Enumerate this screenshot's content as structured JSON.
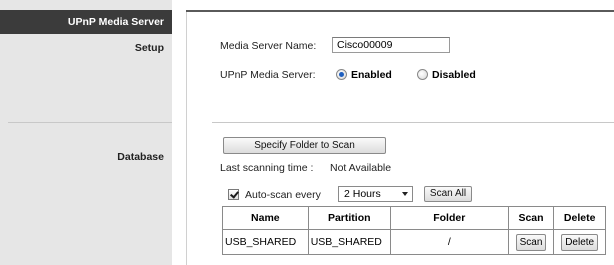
{
  "sidebar": {
    "header": "UPnP Media Server",
    "setup_label": "Setup",
    "database_label": "Database"
  },
  "setup": {
    "server_name_label": "Media Server Name:",
    "server_name_value": "Cisco00009",
    "upnp_label": "UPnP Media Server:",
    "enabled_label": "Enabled",
    "disabled_label": "Disabled",
    "selected": "Enabled"
  },
  "database": {
    "specify_button": "Specify Folder to Scan",
    "last_scan_label": "Last scanning time :",
    "last_scan_value": "Not Available",
    "autoscan_label": "Auto-scan every",
    "autoscan_checked": true,
    "interval_value": "2 Hours",
    "scan_all_button": "Scan All",
    "table": {
      "headers": [
        "Name",
        "Partition",
        "Folder",
        "Scan",
        "Delete"
      ],
      "rows": [
        {
          "name": "USB_SHARED",
          "partition": "USB_SHARED",
          "folder": "/",
          "scan": "Scan",
          "delete": "Delete"
        }
      ]
    }
  },
  "colors": {
    "sidebar_bg": "#e6e6e6",
    "sidebar_header_bg": "#3b3b3b",
    "radio_selected": "#1f5fbf"
  }
}
